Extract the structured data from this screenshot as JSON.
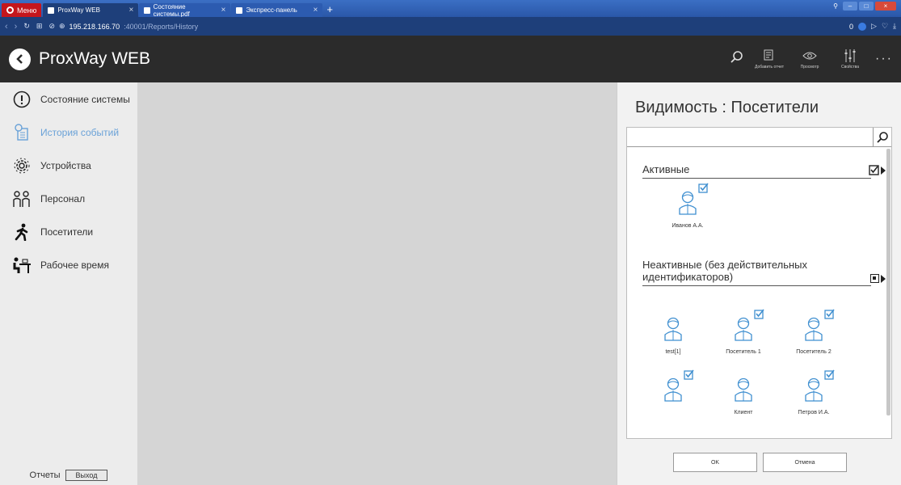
{
  "browser": {
    "menu_label": "Меню",
    "tabs": [
      {
        "title": "ProxWay WEB"
      },
      {
        "title": "Состояние системы.pdf"
      },
      {
        "title": "Экспресс-панель"
      }
    ],
    "url_host": "195.218.166.70",
    "url_rest": ":40001/Reports/History",
    "badge_count": "0"
  },
  "app": {
    "title": "ProxWay WEB",
    "actions": [
      {
        "label": "Добавить отчет",
        "icon": "add-report-icon"
      },
      {
        "label": "Просмотр",
        "icon": "eye-icon"
      },
      {
        "label": "Свойства",
        "icon": "sliders-icon"
      }
    ]
  },
  "sidebar": {
    "items": [
      {
        "label": "Состояние системы",
        "icon": "info-icon"
      },
      {
        "label": "История событий",
        "icon": "history-icon",
        "active": true
      },
      {
        "label": "Устройства",
        "icon": "gears-icon"
      },
      {
        "label": "Персонал",
        "icon": "staff-icon"
      },
      {
        "label": "Посетители",
        "icon": "walking-person-icon"
      },
      {
        "label": "Рабочее время",
        "icon": "desk-icon"
      }
    ],
    "footer_reports": "Отчеты",
    "footer_exit": "Выход"
  },
  "panel": {
    "title": "Видимость : Посетители",
    "search_value": "",
    "groups": [
      {
        "title": "Активные",
        "checked": true,
        "people": [
          {
            "name": "Иванов А.А.",
            "checked": true
          }
        ]
      },
      {
        "title": "Неактивные (без действительных идентификаторов)",
        "checked": "partial",
        "people": [
          {
            "name": "test[1]",
            "checked": false
          },
          {
            "name": "Посетитель 1",
            "checked": true
          },
          {
            "name": "Посетитель 2",
            "checked": true
          },
          {
            "name": "",
            "checked": true
          },
          {
            "name": "Клиент",
            "checked": false
          },
          {
            "name": "Петров И.А.",
            "checked": true
          }
        ]
      }
    ],
    "ok_label": "OK",
    "cancel_label": "Отмена"
  },
  "colors": {
    "accent": "#3f8fd0",
    "header_bg": "#2b2b2b",
    "sidebar_active": "#6aa2d8"
  }
}
